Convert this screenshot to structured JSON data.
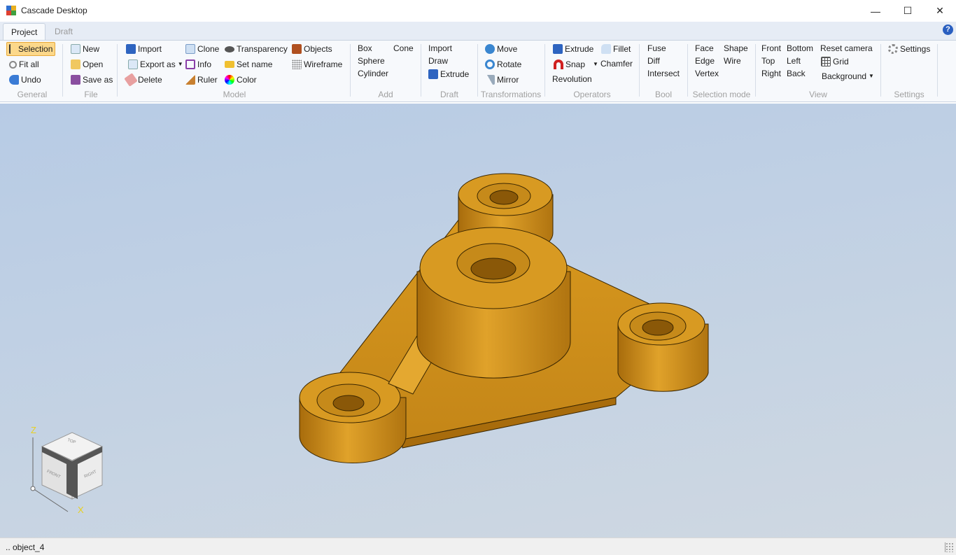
{
  "window": {
    "title": "Cascade Desktop",
    "minimize": "—",
    "maximize": "☐",
    "close": "✕"
  },
  "tabs": [
    {
      "label": "Project",
      "active": true
    },
    {
      "label": "Draft",
      "active": false
    }
  ],
  "help_icon": "?",
  "ribbon": {
    "general": {
      "label": "General",
      "items": [
        "Selection",
        "Fit all",
        "Undo"
      ]
    },
    "file": {
      "label": "File",
      "items": [
        "New",
        "Open",
        "Save as"
      ]
    },
    "model": {
      "label": "Model",
      "items": [
        "Import",
        "Export as",
        "Delete",
        "Clone",
        "Info",
        "Ruler",
        "Transparency",
        "Set name",
        "Color",
        "Objects",
        "Wireframe"
      ]
    },
    "add": {
      "label": "Add",
      "items": [
        "Box",
        "Sphere",
        "Cylinder",
        "Cone"
      ]
    },
    "draft": {
      "label": "Draft",
      "items": [
        "Import",
        "Draw",
        "Extrude"
      ]
    },
    "transformations": {
      "label": "Transformations",
      "items": [
        "Move",
        "Rotate",
        "Mirror"
      ]
    },
    "operators": {
      "label": "Operators",
      "items": [
        "Extrude",
        "Snap",
        "Revolution",
        "Fillet",
        "Chamfer"
      ]
    },
    "bool": {
      "label": "Bool",
      "items": [
        "Fuse",
        "Diff",
        "Intersect"
      ]
    },
    "selection_mode": {
      "label": "Selection mode",
      "items": [
        "Face",
        "Edge",
        "Vertex",
        "Shape",
        "Wire"
      ]
    },
    "view": {
      "label": "View",
      "items": [
        "Front",
        "Top",
        "Right",
        "Bottom",
        "Left",
        "Back",
        "Reset camera",
        "Grid",
        "Background"
      ]
    },
    "settings": {
      "label": "Settings",
      "items": [
        "Settings"
      ]
    }
  },
  "viewcube": {
    "top": "TOP",
    "front": "FRONT",
    "right": "RIGHT",
    "axis_z": "Z",
    "axis_x": "X"
  },
  "status": {
    "text": "..  object_4"
  },
  "colors": {
    "model": "#d4921c",
    "accent": "#fcd88a"
  }
}
